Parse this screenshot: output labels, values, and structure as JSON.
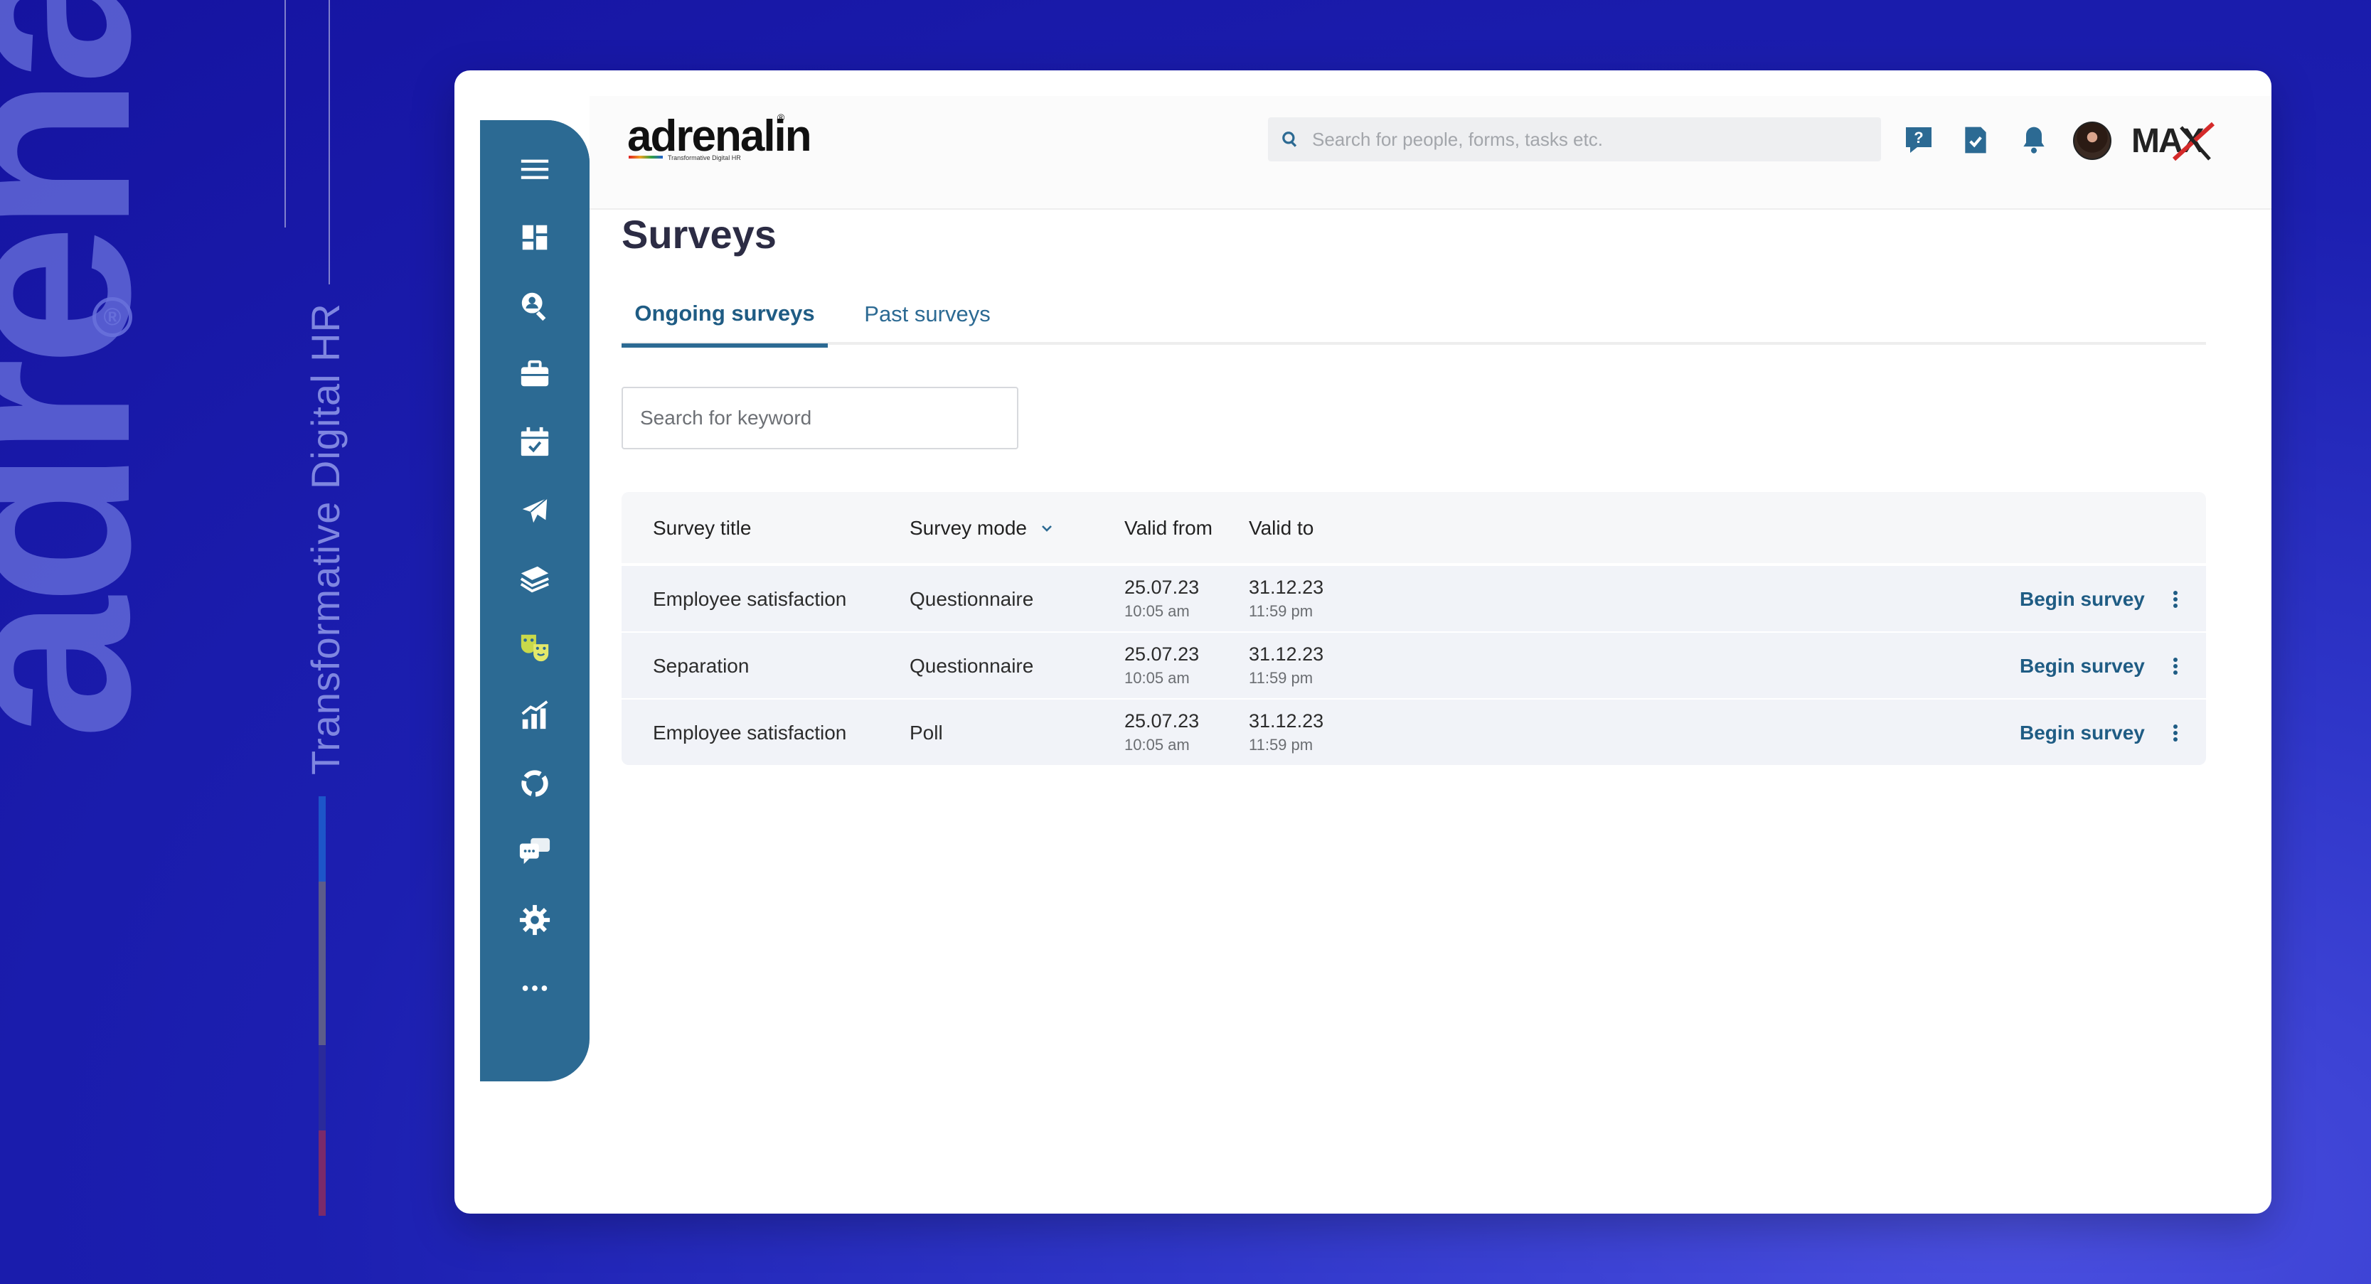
{
  "brand": {
    "wordmark": "adrenalin",
    "registered": "®",
    "tagline": "Transformative Digital HR"
  },
  "topbar": {
    "logo_text": "adrenalin",
    "logo_subtitle": "Transformative Digital HR",
    "search_placeholder": "Search for people, forms, tasks etc.",
    "max_logo_text": "MAX"
  },
  "sidebar": {
    "items": [
      {
        "icon": "menu-icon"
      },
      {
        "icon": "dashboard-icon"
      },
      {
        "icon": "people-search-icon"
      },
      {
        "icon": "briefcase-icon"
      },
      {
        "icon": "calendar-check-icon"
      },
      {
        "icon": "airplane-icon"
      },
      {
        "icon": "money-stack-icon"
      },
      {
        "icon": "theater-masks-icon"
      },
      {
        "icon": "bar-chart-icon"
      },
      {
        "icon": "refresh-ring-icon"
      },
      {
        "icon": "chat-bubbles-icon"
      },
      {
        "icon": "gear-icon"
      },
      {
        "icon": "more-dots-icon"
      }
    ]
  },
  "page": {
    "title": "Surveys",
    "tabs": [
      {
        "label": "Ongoing surveys",
        "active": true
      },
      {
        "label": "Past surveys",
        "active": false
      }
    ],
    "keyword_placeholder": "Search for keyword"
  },
  "table": {
    "headers": {
      "title": "Survey title",
      "mode": "Survey mode",
      "from": "Valid from",
      "to": "Valid to"
    },
    "rows": [
      {
        "title": "Employee satisfaction",
        "mode": "Questionnaire",
        "from_date": "25.07.23",
        "from_time": "10:05 am",
        "to_date": "31.12.23",
        "to_time": "11:59 pm",
        "action": "Begin survey"
      },
      {
        "title": "Separation",
        "mode": "Questionnaire",
        "from_date": "25.07.23",
        "from_time": "10:05 am",
        "to_date": "31.12.23",
        "to_time": "11:59 pm",
        "action": "Begin survey"
      },
      {
        "title": "Employee satisfaction",
        "mode": "Poll",
        "from_date": "25.07.23",
        "from_time": "10:05 am",
        "to_date": "31.12.23",
        "to_time": "11:59 pm",
        "action": "Begin survey"
      }
    ]
  },
  "colors": {
    "sidebar": "#2c6a93",
    "accent": "#1f5c84",
    "background": "#1c1fb0"
  }
}
